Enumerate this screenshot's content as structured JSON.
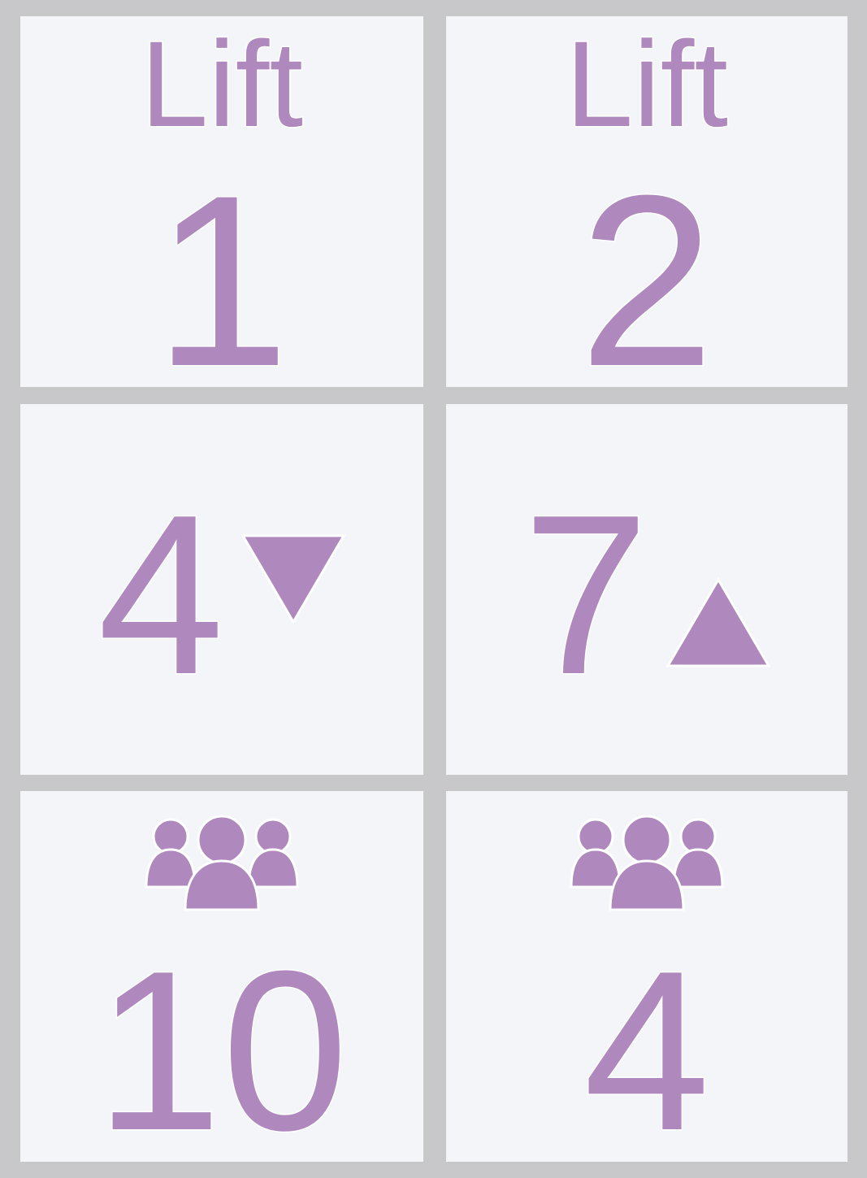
{
  "lifts": [
    {
      "label": "Lift",
      "number": "1",
      "floor": "4",
      "direction": "down",
      "direction_icon": "triangle-down-icon",
      "people_icon": "people-group-icon",
      "passengers": "10"
    },
    {
      "label": "Lift",
      "number": "2",
      "floor": "7",
      "direction": "up",
      "direction_icon": "triangle-up-icon",
      "people_icon": "people-group-icon",
      "passengers": "4"
    }
  ],
  "colors": {
    "accent": "#af89be",
    "cell_background": "#f4f5f8",
    "grid_lines": "#c8c8ca"
  }
}
